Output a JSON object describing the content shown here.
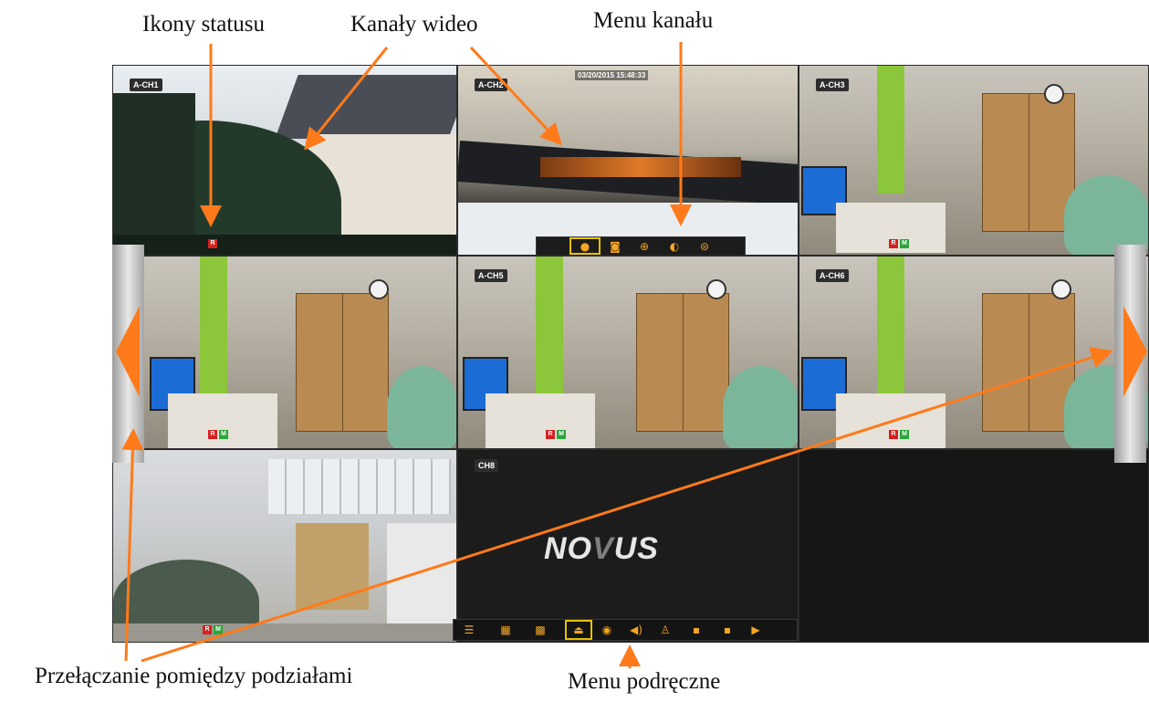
{
  "callouts": {
    "status_icons": "Ikony statusu",
    "video_channels": "Kanały wideo",
    "channel_menu": "Menu kanału",
    "switch_layouts": "Przełączanie pomiędzy podziałami",
    "quick_menu": "Menu podręczne"
  },
  "channels": {
    "ch1": "A-CH1",
    "ch2": "A-CH2",
    "ch3": "A-CH3",
    "ch5": "A-CH5",
    "ch6": "A-CH6",
    "ch8": "CH8"
  },
  "timestamp": "03/20/2015 15:48:33",
  "status": {
    "rec": "R",
    "motion": "M"
  },
  "logo": {
    "prefix": "NO",
    "mid": "V",
    "suffix": "US"
  },
  "channel_menu_icons": [
    "record-icon",
    "snapshot-icon",
    "zoom-icon",
    "color-adjust-icon",
    "ptz-icon"
  ],
  "quick_menu_icons": [
    "single-view-icon",
    "quad-view-icon",
    "nine-view-icon",
    "sequence-icon",
    "playback-icon",
    "audio-icon",
    "ptz-icon",
    "record-icon",
    "snapshot-icon",
    "play-icon"
  ],
  "colors": {
    "arrow": "#ff7a1a",
    "toolbar_icon": "#f5a623",
    "selected_outline": "#e6c200"
  }
}
